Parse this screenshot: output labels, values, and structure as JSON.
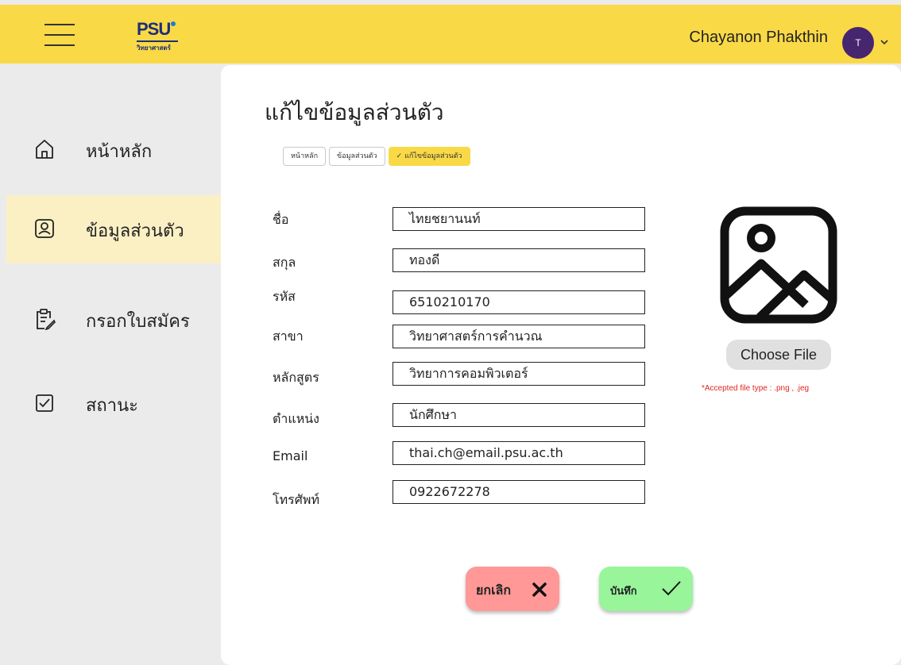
{
  "header": {
    "logo_mark": "PSU",
    "logo_sub": "วิทยาศาสตร์",
    "username": "Chayanon Phakthin",
    "avatar_initial": "T"
  },
  "sidebar": {
    "items": [
      {
        "label": "หน้าหลัก",
        "icon": "home-icon",
        "active": false
      },
      {
        "label": "ข้อมูลส่วนตัว",
        "icon": "profile-icon",
        "active": true
      },
      {
        "label": "กรอกใบสมัคร",
        "icon": "clipboard-edit-icon",
        "active": false
      },
      {
        "label": "สถานะ",
        "icon": "checkbox-icon",
        "active": false
      }
    ]
  },
  "main": {
    "title": "แก้ไขข้อมูลส่วนตัว",
    "breadcrumbs": [
      "หน้าหลัก",
      "ข้อมูลส่วนตัว",
      "แก้ไขข้อมูลส่วนตัว"
    ],
    "breadcrumb_check": "✓",
    "fields": [
      {
        "label": "ชื่อ",
        "value": "ไทยชยานนท์"
      },
      {
        "label": "สกุล",
        "value": "ทองดี"
      },
      {
        "label": "รหัส",
        "value": "6510210170"
      },
      {
        "label": "สาขา",
        "value": "วิทยาศาสตร์การคำนวณ"
      },
      {
        "label": "หลักสูตร",
        "value": "วิทยาการคอมพิวเตอร์"
      },
      {
        "label": "ตำแหน่ง",
        "value": "นักศึกษา"
      },
      {
        "label": "Email",
        "value": "thai.ch@email.psu.ac.th"
      },
      {
        "label": "โทรศัพท์",
        "value": "0922672278"
      }
    ],
    "photo": {
      "choose_label": "Choose  File",
      "accepted_text": "*Accepted file type :  .png  ,  .jeg"
    },
    "actions": {
      "cancel_label": "ยกเลิก",
      "save_label": "บันทึก"
    }
  },
  "colors": {
    "header_bg": "#fad947",
    "active_nav_bg": "#fbf0c4",
    "cancel_bg": "#ff9896",
    "save_bg": "#98f59a",
    "avatar_bg": "#46266e",
    "accent_red": "#e0251f"
  }
}
